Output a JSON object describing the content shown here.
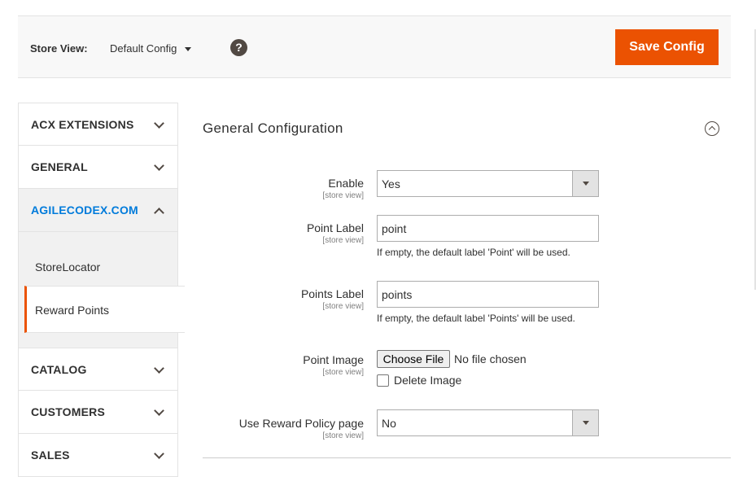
{
  "header": {
    "store_view_label": "Store View:",
    "store_view_value": "Default Config",
    "help_glyph": "?",
    "save_label": "Save Config",
    "accent_color": "#eb5202"
  },
  "sidebar": {
    "sections": [
      {
        "label": "ACX EXTENSIONS",
        "expanded": false
      },
      {
        "label": "GENERAL",
        "expanded": false
      },
      {
        "label": "AGILECODEX.COM",
        "expanded": true
      },
      {
        "label": "CATALOG",
        "expanded": false
      },
      {
        "label": "CUSTOMERS",
        "expanded": false
      },
      {
        "label": "SALES",
        "expanded": false
      }
    ],
    "sub_items": [
      {
        "label": "StoreLocator",
        "active": false
      },
      {
        "label": "Reward Points",
        "active": true
      }
    ],
    "active_color": "#007bdb"
  },
  "main": {
    "section_title": "General Configuration",
    "fields": {
      "enable": {
        "label": "Enable",
        "scope": "[store view]",
        "value": "Yes"
      },
      "point_label": {
        "label": "Point Label",
        "scope": "[store view]",
        "value": "point",
        "note": "If empty, the default label 'Point' will be used."
      },
      "points_label": {
        "label": "Points Label",
        "scope": "[store view]",
        "value": "points",
        "note": "If empty, the default label 'Points' will be used."
      },
      "point_image": {
        "label": "Point Image",
        "scope": "[store view]",
        "button": "Choose File",
        "status": "No file chosen",
        "delete_label": "Delete Image"
      },
      "reward_policy": {
        "label": "Use Reward Policy page",
        "scope": "[store view]",
        "value": "No"
      }
    }
  }
}
